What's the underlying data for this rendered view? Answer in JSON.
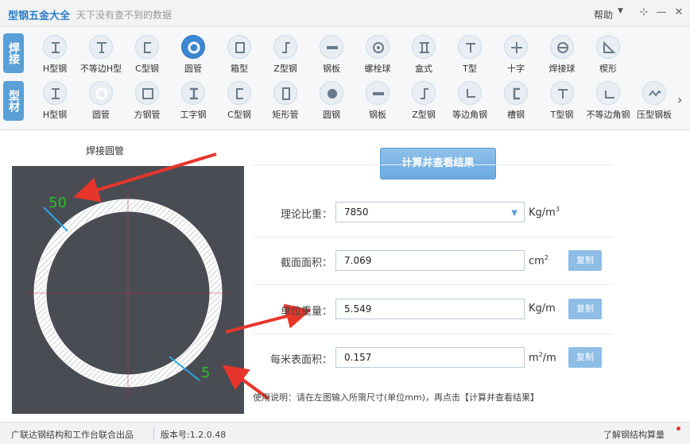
{
  "titlebar": {
    "app_title": "型钢五金大全",
    "subtitle": "天下没有查不到的数据",
    "help_label": "帮助",
    "controls": [
      "⊹",
      "—",
      "✕"
    ]
  },
  "categories": {
    "weld": "焊接",
    "profile": "型材"
  },
  "weld_tools": [
    {
      "label": "H型钢",
      "icon": "h-beam-icon"
    },
    {
      "label": "不等边H型",
      "icon": "unequal-h-beam-icon"
    },
    {
      "label": "C型钢",
      "icon": "c-channel-icon"
    },
    {
      "label": "圆管",
      "icon": "round-pipe-icon"
    },
    {
      "label": "箱型",
      "icon": "box-section-icon"
    },
    {
      "label": "Z型钢",
      "icon": "z-section-icon"
    },
    {
      "label": "钢板",
      "icon": "steel-plate-icon"
    },
    {
      "label": "螺栓球",
      "icon": "bolt-ball-icon"
    },
    {
      "label": "盒式",
      "icon": "box-type-icon"
    },
    {
      "label": "T型",
      "icon": "t-section-icon"
    },
    {
      "label": "十字",
      "icon": "cross-section-icon"
    },
    {
      "label": "焊接球",
      "icon": "welded-ball-icon"
    },
    {
      "label": "楔形",
      "icon": "wedge-icon"
    }
  ],
  "profile_tools": [
    {
      "label": "H型钢",
      "icon": "h-beam-icon"
    },
    {
      "label": "圆管",
      "icon": "round-pipe-icon"
    },
    {
      "label": "方钢管",
      "icon": "square-tube-icon"
    },
    {
      "label": "工字钢",
      "icon": "i-beam-icon"
    },
    {
      "label": "C型钢",
      "icon": "c-channel-icon"
    },
    {
      "label": "矩形管",
      "icon": "rect-tube-icon"
    },
    {
      "label": "圆钢",
      "icon": "round-bar-icon"
    },
    {
      "label": "钢板",
      "icon": "steel-plate-icon"
    },
    {
      "label": "Z型钢",
      "icon": "z-section-icon"
    },
    {
      "label": "等边角钢",
      "icon": "equal-angle-icon"
    },
    {
      "label": "槽钢",
      "icon": "channel-icon"
    },
    {
      "label": "T型钢",
      "icon": "t-section-icon"
    },
    {
      "label": "不等边角钢",
      "icon": "unequal-angle-icon"
    },
    {
      "label": "压型钢板",
      "icon": "profiled-sheet-icon"
    }
  ],
  "drawing": {
    "title": "焊接圆管",
    "diameter_value": "50",
    "thickness_value": "5"
  },
  "form": {
    "calc_button": "计算并查看结果",
    "density_label": "理论比重：",
    "density_value": "7850",
    "density_unit": "Kg/m",
    "density_unit_sup": "3",
    "area_label": "截面面积：",
    "area_value": "7.069",
    "area_unit": "cm",
    "area_unit_sup": "2",
    "weight_label": "单位重量：",
    "weight_value": "5.549",
    "weight_unit": "Kg/m",
    "surface_label": "每米表面积：",
    "surface_value": "0.157",
    "surface_unit_pre": "m",
    "surface_unit_sup": "2",
    "surface_unit_post": "/m",
    "copy_label": "复制",
    "usage": "使用说明：请在左图输入所需尺寸(单位mm)，再点击【计算并查看结果】"
  },
  "status": {
    "left": "广联达钢结构和工作台联合出品",
    "version": "版本号:1.2.0.48",
    "right": "了解钢结构算量"
  },
  "colors": {
    "accent": "#3b87d2",
    "button": "#8ebde6",
    "canvas": "#4a4c54",
    "annotation_arrow": "#e8352b",
    "dimension_text": "#22c322"
  }
}
